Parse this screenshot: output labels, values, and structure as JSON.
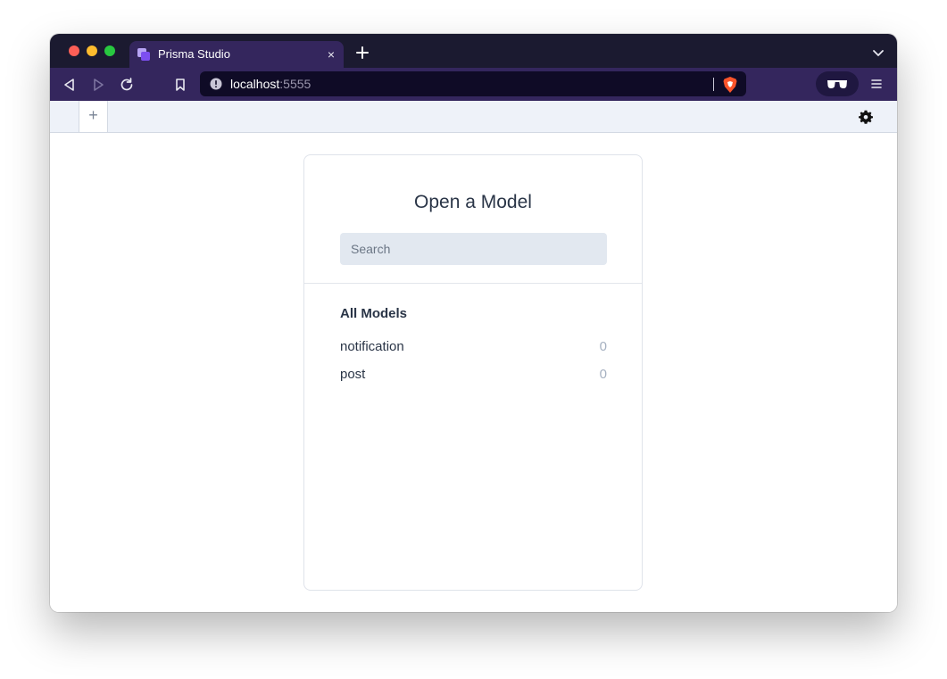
{
  "browser": {
    "tab": {
      "title": "Prisma Studio",
      "close_glyph": "×"
    },
    "new_tab_icon": "plus-icon",
    "url": {
      "host": "localhost",
      "port": ":5555"
    },
    "icons": [
      "back-arrow-icon",
      "forward-arrow-icon",
      "reload-icon",
      "bookmark-icon",
      "site-info-icon",
      "brave-shield-icon",
      "private-glasses-icon",
      "hamburger-menu-icon",
      "tab-list-chevron-icon"
    ],
    "colors": {
      "tabstrip": "#1b1a30",
      "toolbar": "#34265d",
      "urlbar": "#0f0b26"
    }
  },
  "app": {
    "header": {
      "add_tab_label": "+",
      "settings_icon": "gear-icon"
    },
    "card": {
      "title": "Open a Model",
      "search_placeholder": "Search",
      "section_heading": "All Models",
      "models": [
        {
          "name": "notification",
          "count": "0"
        },
        {
          "name": "post",
          "count": "0"
        }
      ]
    }
  }
}
